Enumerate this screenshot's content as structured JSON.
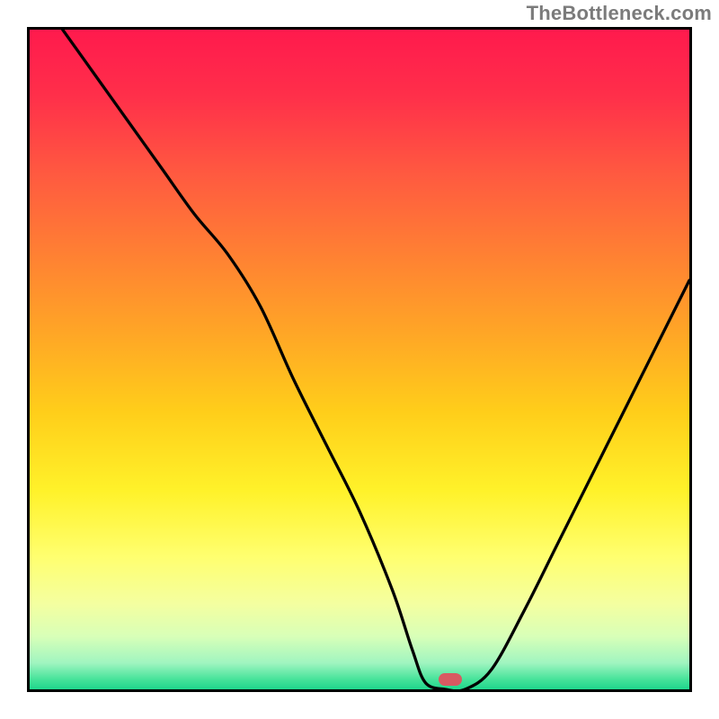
{
  "watermark": "TheBottleneck.com",
  "gradient_stops": [
    {
      "offset": 0.0,
      "color": "#ff1a4d"
    },
    {
      "offset": 0.1,
      "color": "#ff2f4a"
    },
    {
      "offset": 0.22,
      "color": "#ff5a40"
    },
    {
      "offset": 0.34,
      "color": "#ff8033"
    },
    {
      "offset": 0.46,
      "color": "#ffa626"
    },
    {
      "offset": 0.58,
      "color": "#ffce1a"
    },
    {
      "offset": 0.7,
      "color": "#fff22a"
    },
    {
      "offset": 0.8,
      "color": "#ffff70"
    },
    {
      "offset": 0.87,
      "color": "#f4ffa0"
    },
    {
      "offset": 0.92,
      "color": "#d8ffb8"
    },
    {
      "offset": 0.96,
      "color": "#a0f5c0"
    },
    {
      "offset": 0.985,
      "color": "#46e39a"
    },
    {
      "offset": 1.0,
      "color": "#1fd68c"
    }
  ],
  "marker": {
    "x_frac": 0.638,
    "y_frac": 0.985,
    "color": "#d85a62"
  },
  "chart_data": {
    "type": "line",
    "title": "",
    "xlabel": "",
    "ylabel": "",
    "xlim": [
      0,
      100
    ],
    "ylim": [
      0,
      100
    ],
    "x": [
      5,
      10,
      15,
      20,
      25,
      30,
      35,
      40,
      45,
      50,
      55,
      58,
      60,
      63,
      66,
      70,
      75,
      80,
      85,
      90,
      95,
      100
    ],
    "series": [
      {
        "name": "bottleneck-curve",
        "values": [
          100,
          93,
          86,
          79,
          72,
          66,
          58,
          47,
          37,
          27,
          15,
          6,
          1,
          0,
          0,
          3,
          12,
          22,
          32,
          42,
          52,
          62
        ]
      }
    ],
    "minimum_marker": {
      "x": 64,
      "y": 0,
      "color": "#d85a62"
    },
    "background": "vertical heat gradient red→orange→yellow→green",
    "note": "Axes are unlabeled in the source image; values read off proportionally from the plot border."
  }
}
